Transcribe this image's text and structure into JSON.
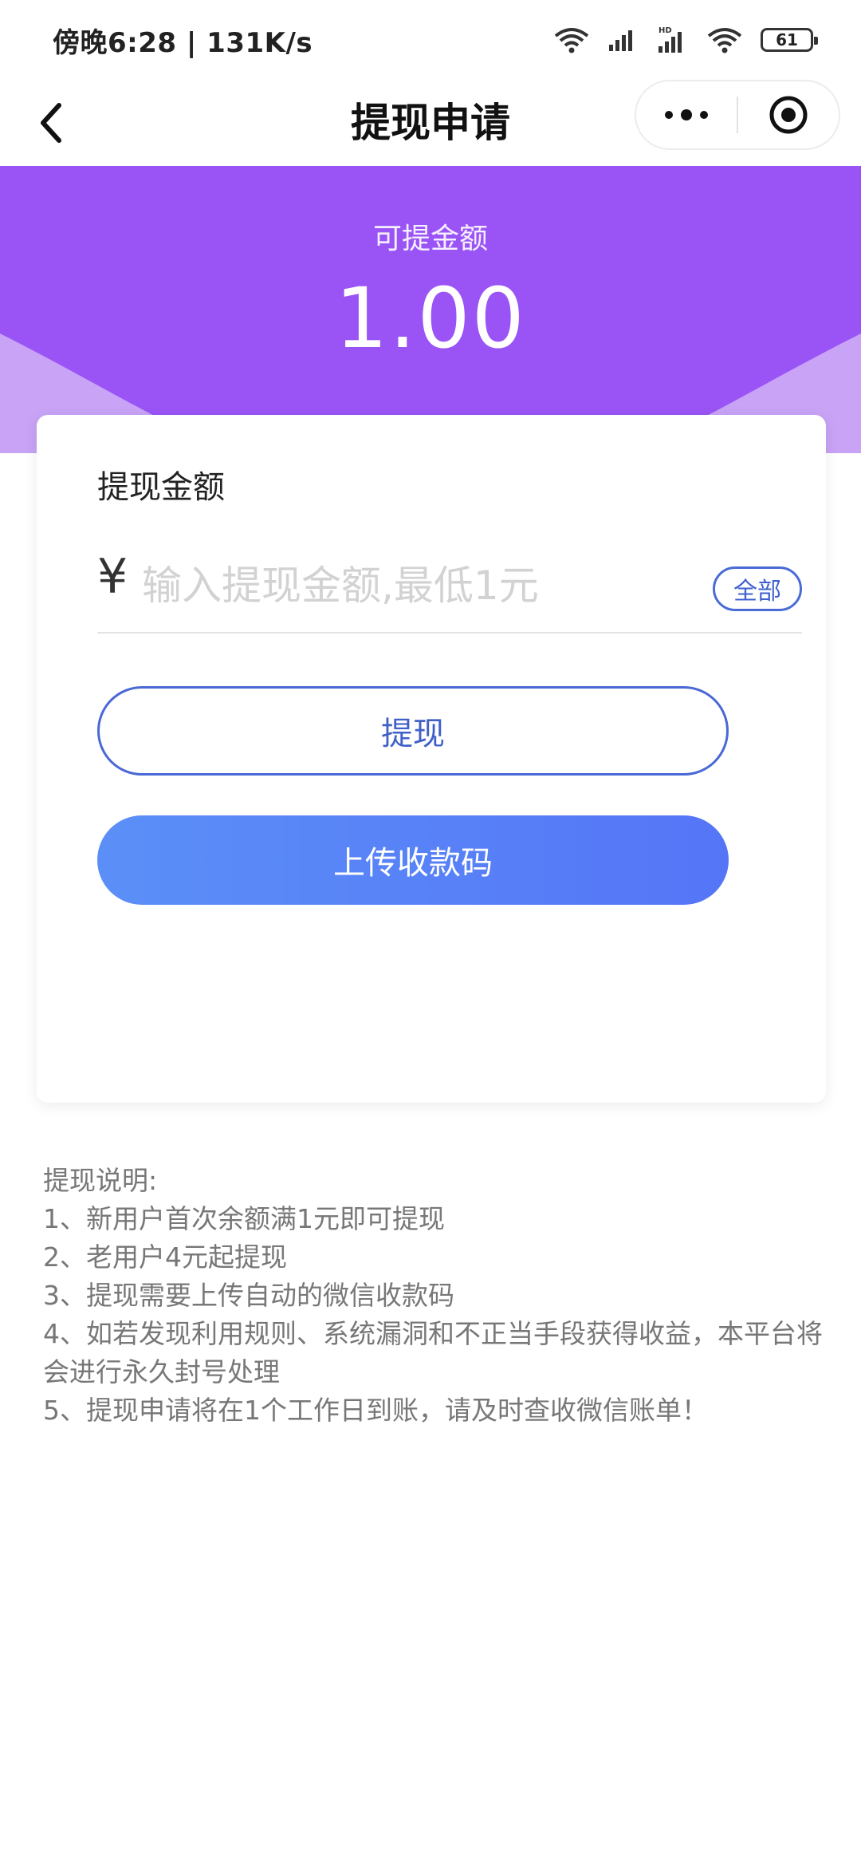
{
  "status_bar": {
    "time_speed": "傍晚6:28 | 131K/s",
    "battery": "61"
  },
  "nav": {
    "title": "提现申请"
  },
  "balance": {
    "label": "可提金额",
    "amount": "1.00"
  },
  "form": {
    "amount_label": "提现金额",
    "currency_symbol": "¥",
    "amount_value": "",
    "amount_placeholder": "输入提现金额,最低1元",
    "all_label": "全部",
    "withdraw_label": "提现",
    "upload_label": "上传收款码"
  },
  "notes": {
    "title": "提现说明:",
    "items": [
      "1、新用户首次余额满1元即可提现",
      "2、老用户4元起提现",
      "3、提现需要上传自动的微信收款码",
      "4、如若发现利用规则、系统漏洞和不正当手段获得收益，本平台将会进行永久封号处理",
      "5、提现申请将在1个工作日到账，请及时查收微信账单！"
    ]
  },
  "colors": {
    "header_purple": "#9a54f6",
    "button_blue": "#5575f7",
    "outline_blue": "#4a68d6"
  }
}
